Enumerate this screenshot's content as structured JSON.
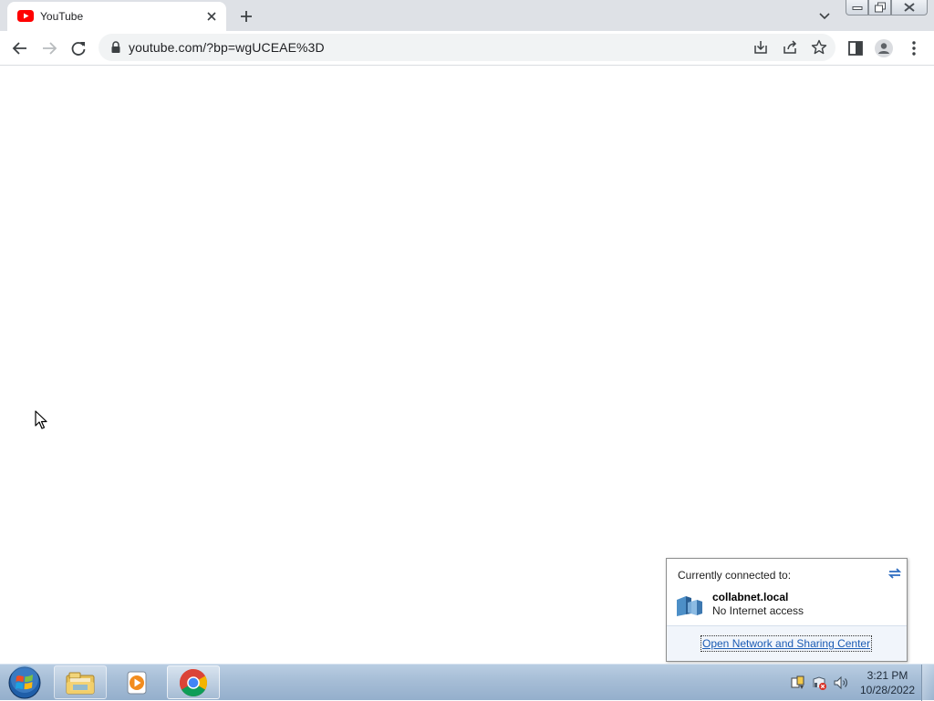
{
  "browser": {
    "tab": {
      "title": "YouTube",
      "favicon": "youtube-icon"
    },
    "address": {
      "url": "youtube.com/?bp=wgUCEAE%3D"
    },
    "colors": {
      "tabstrip": "#dee1e6",
      "youtube_red": "#ff0000"
    }
  },
  "network_popup": {
    "header": "Currently connected to:",
    "network_name": "collabnet.local",
    "status": "No Internet access",
    "link": "Open Network and Sharing Center"
  },
  "taskbar": {
    "apps": [
      "windows-explorer-icon",
      "media-player-icon",
      "chrome-icon"
    ],
    "clock": {
      "time": "3:21 PM",
      "date": "10/28/2022"
    }
  }
}
